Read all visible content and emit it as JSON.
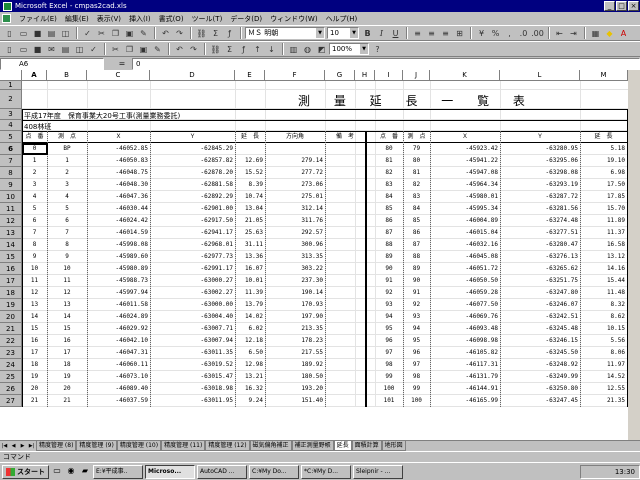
{
  "window": {
    "title": "Microsoft Excel - cmpas2cad.xls"
  },
  "menu": [
    "ファイル(E)",
    "編集(E)",
    "表示(V)",
    "挿入(I)",
    "書式(O)",
    "ツール(T)",
    "データ(D)",
    "ウィンドウ(W)",
    "ヘルプ(H)"
  ],
  "toolbar": {
    "font": "ＭＳ 明朝",
    "size": "10",
    "zoom": "100%"
  },
  "formula": {
    "cell": "A6",
    "equals": "=",
    "value": "0"
  },
  "columns": [
    "A",
    "B",
    "C",
    "D",
    "E",
    "F",
    "G",
    "H",
    "I",
    "J",
    "K",
    "L",
    "M"
  ],
  "sheet_title": "測 量 延 長 一 覧 表",
  "subtitle": "平成17年度　保育事業大20号工事(測量業務委託)",
  "forest": "408林班",
  "headers_left": [
    "点　番",
    "測　点",
    "Ｘ",
    "Ｙ",
    "延　長",
    "方向角",
    "備　考"
  ],
  "headers_right": [
    "点　番",
    "測　点",
    "Ｘ",
    "Ｙ",
    "延　長"
  ],
  "rows": [
    {
      "n": "6",
      "a": "0",
      "b": "BP",
      "c": "-46052.85",
      "d": "-62845.29",
      "e": "",
      "f": "",
      "i": "80",
      "j": "79",
      "k": "-45923.42",
      "l": "-63280.95",
      "m": "5.18"
    },
    {
      "n": "7",
      "a": "1",
      "b": "1",
      "c": "-46050.83",
      "d": "-62857.82",
      "e": "12.69",
      "f": "279.14",
      "i": "81",
      "j": "80",
      "k": "-45941.22",
      "l": "-63295.06",
      "m": "19.10"
    },
    {
      "n": "8",
      "a": "2",
      "b": "2",
      "c": "-46048.75",
      "d": "-62878.20",
      "e": "15.52",
      "f": "277.72",
      "i": "82",
      "j": "81",
      "k": "-45947.08",
      "l": "-63298.08",
      "m": "6.98"
    },
    {
      "n": "9",
      "a": "3",
      "b": "3",
      "c": "-46048.30",
      "d": "-62881.58",
      "e": "8.39",
      "f": "273.06",
      "i": "83",
      "j": "82",
      "k": "-45964.34",
      "l": "-63293.19",
      "m": "17.50"
    },
    {
      "n": "10",
      "a": "4",
      "b": "4",
      "c": "-46047.36",
      "d": "-62892.29",
      "e": "10.74",
      "f": "275.01",
      "i": "84",
      "j": "83",
      "k": "-45980.01",
      "l": "-63287.72",
      "m": "17.85"
    },
    {
      "n": "11",
      "a": "5",
      "b": "5",
      "c": "-46030.44",
      "d": "-62901.00",
      "e": "13.04",
      "f": "312.14",
      "i": "85",
      "j": "84",
      "k": "-45995.34",
      "l": "-63281.56",
      "m": "15.70"
    },
    {
      "n": "12",
      "a": "6",
      "b": "6",
      "c": "-46024.42",
      "d": "-62917.50",
      "e": "21.05",
      "f": "311.76",
      "i": "86",
      "j": "85",
      "k": "-46004.89",
      "l": "-63274.48",
      "m": "11.89"
    },
    {
      "n": "13",
      "a": "7",
      "b": "7",
      "c": "-46014.59",
      "d": "-62941.17",
      "e": "25.63",
      "f": "292.57",
      "i": "87",
      "j": "86",
      "k": "-46015.04",
      "l": "-63277.51",
      "m": "11.37"
    },
    {
      "n": "14",
      "a": "8",
      "b": "8",
      "c": "-45998.08",
      "d": "-62968.01",
      "e": "31.11",
      "f": "300.96",
      "i": "88",
      "j": "87",
      "k": "-46032.16",
      "l": "-63280.47",
      "m": "16.58"
    },
    {
      "n": "15",
      "a": "9",
      "b": "9",
      "c": "-45989.60",
      "d": "-62977.73",
      "e": "13.36",
      "f": "313.35",
      "i": "89",
      "j": "88",
      "k": "-46045.08",
      "l": "-63276.13",
      "m": "13.12"
    },
    {
      "n": "16",
      "a": "10",
      "b": "10",
      "c": "-45980.89",
      "d": "-62991.17",
      "e": "16.07",
      "f": "303.22",
      "i": "90",
      "j": "89",
      "k": "-46051.72",
      "l": "-63265.62",
      "m": "14.16"
    },
    {
      "n": "17",
      "a": "11",
      "b": "11",
      "c": "-45988.73",
      "d": "-63000.27",
      "e": "10.01",
      "f": "237.30",
      "i": "91",
      "j": "90",
      "k": "-46050.50",
      "l": "-63251.75",
      "m": "15.44"
    },
    {
      "n": "18",
      "a": "12",
      "b": "12",
      "c": "-45997.94",
      "d": "-63002.27",
      "e": "11.39",
      "f": "190.14",
      "i": "92",
      "j": "91",
      "k": "-46059.28",
      "l": "-63247.80",
      "m": "11.48"
    },
    {
      "n": "19",
      "a": "13",
      "b": "13",
      "c": "-46011.58",
      "d": "-63000.00",
      "e": "13.79",
      "f": "170.93",
      "i": "93",
      "j": "92",
      "k": "-46077.50",
      "l": "-63246.07",
      "m": "8.32"
    },
    {
      "n": "20",
      "a": "14",
      "b": "14",
      "c": "-46024.89",
      "d": "-63004.40",
      "e": "14.02",
      "f": "197.90",
      "i": "94",
      "j": "93",
      "k": "-46069.76",
      "l": "-63242.51",
      "m": "8.62"
    },
    {
      "n": "21",
      "a": "15",
      "b": "15",
      "c": "-46029.92",
      "d": "-63007.71",
      "e": "6.02",
      "f": "213.35",
      "i": "95",
      "j": "94",
      "k": "-46093.48",
      "l": "-63245.48",
      "m": "10.15"
    },
    {
      "n": "22",
      "a": "16",
      "b": "16",
      "c": "-46042.10",
      "d": "-63007.94",
      "e": "12.18",
      "f": "178.23",
      "i": "96",
      "j": "95",
      "k": "-46098.98",
      "l": "-63246.15",
      "m": "5.56"
    },
    {
      "n": "23",
      "a": "17",
      "b": "17",
      "c": "-46047.31",
      "d": "-63011.35",
      "e": "6.50",
      "f": "217.55",
      "i": "97",
      "j": "96",
      "k": "-46105.82",
      "l": "-63245.50",
      "m": "8.06"
    },
    {
      "n": "24",
      "a": "18",
      "b": "18",
      "c": "-46060.11",
      "d": "-63019.52",
      "e": "12.98",
      "f": "189.92",
      "i": "98",
      "j": "97",
      "k": "-46117.31",
      "l": "-63248.92",
      "m": "11.97"
    },
    {
      "n": "25",
      "a": "19",
      "b": "19",
      "c": "-46073.10",
      "d": "-63015.47",
      "e": "13.21",
      "f": "180.50",
      "i": "99",
      "j": "98",
      "k": "-46131.79",
      "l": "-63249.99",
      "m": "14.52"
    },
    {
      "n": "26",
      "a": "20",
      "b": "20",
      "c": "-46089.40",
      "d": "-63018.98",
      "e": "16.32",
      "f": "193.20",
      "i": "100",
      "j": "99",
      "k": "-46144.91",
      "l": "-63250.80",
      "m": "12.55"
    },
    {
      "n": "27",
      "a": "21",
      "b": "21",
      "c": "-46037.59",
      "d": "-63011.95",
      "e": "9.24",
      "f": "151.40",
      "i": "101",
      "j": "100",
      "k": "-46165.99",
      "l": "-63247.45",
      "m": "21.35"
    }
  ],
  "tabs": [
    "精度管理 (8)",
    "精度管理 (9)",
    "精度管理 (10)",
    "精度管理 (11)",
    "精度管理 (12)",
    "磁気偏角補正",
    "補正測量野帳",
    "延長",
    "面積計算",
    "地形図"
  ],
  "status": "コマンド",
  "taskbar": {
    "start": "スタート",
    "items": [
      "E:¥平成事..",
      "Microso...",
      "AutoCAD ...",
      "C:¥My Do...",
      "*C:¥My D...",
      "Sleipnir - ..."
    ],
    "clock": "13:30"
  }
}
